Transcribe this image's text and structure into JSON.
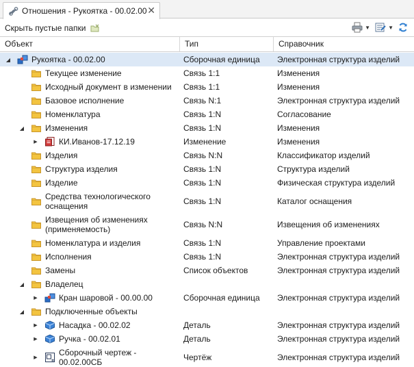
{
  "tab": {
    "title": "Отношения - Рукоятка - 00.02.00",
    "close_icon": "close-icon"
  },
  "toolbar": {
    "hide_empty_label": "Скрыть пустые папки"
  },
  "columns": {
    "object": "Объект",
    "type": "Тип",
    "reference": "Справочник"
  },
  "colors": {
    "folder": "#e9b52a",
    "selection": "#dce8f6",
    "grid_line": "#d0d0d0"
  },
  "rows": [
    {
      "name": "Рукоятка - 00.02.00",
      "type": "Сборочная единица",
      "ref": "Электронная структура изделий",
      "icon": "assembly-icon",
      "level": 0,
      "expander": "expanded",
      "selected": true
    },
    {
      "name": "Текущее изменение",
      "type": "Связь 1:1",
      "ref": "Изменения",
      "icon": "folder-icon",
      "level": 1,
      "expander": "none"
    },
    {
      "name": "Исходный документ в изменении",
      "type": "Связь 1:1",
      "ref": "Изменения",
      "icon": "folder-icon",
      "level": 1,
      "expander": "none"
    },
    {
      "name": "Базовое исполнение",
      "type": "Связь N:1",
      "ref": "Электронная структура изделий",
      "icon": "folder-icon",
      "level": 1,
      "expander": "none"
    },
    {
      "name": "Номенклатура",
      "type": "Связь 1:N",
      "ref": "Согласование",
      "icon": "folder-icon",
      "level": 1,
      "expander": "none"
    },
    {
      "name": "Изменения",
      "type": "Связь 1:N",
      "ref": "Изменения",
      "icon": "folder-icon",
      "level": 1,
      "expander": "expanded"
    },
    {
      "name": "КИ.Иванов-17.12.19",
      "type": "Изменение",
      "ref": "Изменения",
      "icon": "change-notice-icon",
      "level": 2,
      "expander": "collapsed"
    },
    {
      "name": "Изделия",
      "type": "Связь N:N",
      "ref": "Классификатор изделий",
      "icon": "folder-icon",
      "level": 1,
      "expander": "none"
    },
    {
      "name": "Структура изделия",
      "type": "Связь 1:N",
      "ref": "Структура изделий",
      "icon": "folder-icon",
      "level": 1,
      "expander": "none"
    },
    {
      "name": "Изделие",
      "type": "Связь 1:N",
      "ref": "Физическая структура изделий",
      "icon": "folder-icon",
      "level": 1,
      "expander": "none"
    },
    {
      "name": "Средства технологического оснащения",
      "type": "Связь 1:N",
      "ref": "Каталог оснащения",
      "icon": "folder-icon",
      "level": 1,
      "expander": "none",
      "tall": true
    },
    {
      "name": "Извещения об изменениях (применяемость)",
      "type": "Связь N:N",
      "ref": "Извещения об изменениях",
      "icon": "folder-icon",
      "level": 1,
      "expander": "none",
      "tall": true
    },
    {
      "name": "Номенклатура и изделия",
      "type": "Связь 1:N",
      "ref": "Управление проектами",
      "icon": "folder-icon",
      "level": 1,
      "expander": "none"
    },
    {
      "name": "Исполнения",
      "type": "Связь 1:N",
      "ref": "Электронная структура изделий",
      "icon": "folder-icon",
      "level": 1,
      "expander": "none"
    },
    {
      "name": "Замены",
      "type": "Список объектов",
      "ref": "Электронная структура изделий",
      "icon": "folder-icon",
      "level": 1,
      "expander": "none"
    },
    {
      "name": "Владелец",
      "type": "",
      "ref": "",
      "icon": "folder-icon",
      "level": 1,
      "expander": "expanded"
    },
    {
      "name": "Кран шаровой - 00.00.00",
      "type": "Сборочная единица",
      "ref": "Электронная структура изделий",
      "icon": "assembly-icon",
      "level": 2,
      "expander": "collapsed"
    },
    {
      "name": "Подключенные объекты",
      "type": "",
      "ref": "",
      "icon": "folder-icon",
      "level": 1,
      "expander": "expanded"
    },
    {
      "name": "Насадка - 00.02.02",
      "type": "Деталь",
      "ref": "Электронная структура изделий",
      "icon": "part-icon",
      "level": 2,
      "expander": "collapsed"
    },
    {
      "name": "Ручка - 00.02.01",
      "type": "Деталь",
      "ref": "Электронная структура изделий",
      "icon": "part-icon",
      "level": 2,
      "expander": "collapsed"
    },
    {
      "name": "Сборочный чертеж - 00.02.00СБ",
      "type": "Чертёж",
      "ref": "Электронная структура изделий",
      "icon": "drawing-icon",
      "level": 2,
      "expander": "collapsed",
      "tall": true
    }
  ]
}
